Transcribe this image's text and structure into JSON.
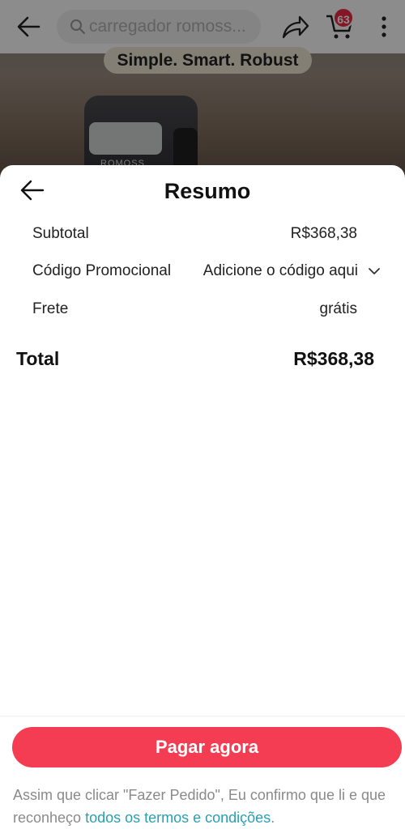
{
  "background_page": {
    "search_placeholder": "carregador romoss...",
    "cart_count": "63",
    "banner_text": "Simple. Smart. Robust",
    "device_logo": "ROMOSS"
  },
  "sheet": {
    "title": "Resumo",
    "subtotal_label": "Subtotal",
    "subtotal_value": "R$368,38",
    "promo_label": "Código Promocional",
    "promo_action": "Adicione o código aqui",
    "frete_label": "Frete",
    "frete_value": "grátis",
    "total_label": "Total",
    "total_value": "R$368,38"
  },
  "footer": {
    "pay_button": "Pagar agora",
    "terms_text": "Assim que clicar \"Fazer Pedido\", Eu confirmo que li e que reconheço ",
    "terms_link": "todos os termos e condições",
    "terms_end": "."
  },
  "colors": {
    "accent": "#f43d52",
    "link": "#2a9fb0",
    "badge": "#ef2a45"
  },
  "icons": [
    "back-arrow-icon",
    "search-icon",
    "share-icon",
    "cart-icon",
    "more-vertical-icon",
    "chevron-down-icon"
  ]
}
